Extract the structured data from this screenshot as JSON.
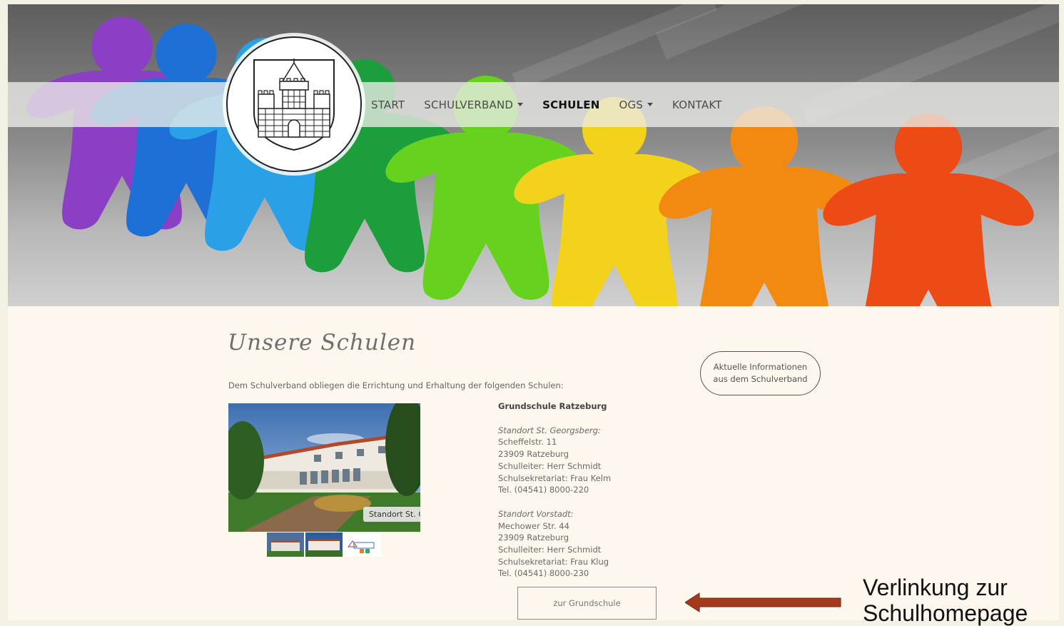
{
  "nav": {
    "items": [
      {
        "label": "START",
        "has_dropdown": false,
        "active": false
      },
      {
        "label": "SCHULVERBAND",
        "has_dropdown": true,
        "active": false
      },
      {
        "label": "SCHULEN",
        "has_dropdown": false,
        "active": true
      },
      {
        "label": "OGS",
        "has_dropdown": true,
        "active": false
      },
      {
        "label": "KONTAKT",
        "has_dropdown": false,
        "active": false
      }
    ]
  },
  "logo": {
    "icon": "castle-coat-of-arms"
  },
  "content": {
    "title": "Unsere Schulen",
    "intro": "Dem Schulverband obliegen die Errichtung und Erhaltung der folgenden Schulen:",
    "gallery": {
      "caption": "Standort St. Ge",
      "thumbnails": [
        "thumbnail-building-1",
        "thumbnail-building-2",
        "thumbnail-school-logo"
      ]
    },
    "school": {
      "name": "Grundschule Ratzeburg",
      "locations": [
        {
          "heading": "Standort St. Georgsberg:",
          "lines": [
            "Scheffelstr. 11",
            "23909 Ratzeburg",
            "Schulleiter: Herr Schmidt",
            "Schulsekretariat: Frau Kelm",
            "Tel. (04541) 8000-220"
          ]
        },
        {
          "heading": "Standort Vorstadt:",
          "lines": [
            "Mechower Str. 44",
            "23909 Ratzeburg",
            "Schulleiter: Herr Schmidt",
            "Schulsekretariat: Frau Klug",
            "Tel. (04541) 8000-230"
          ]
        }
      ],
      "button_label": "zur Grundschule"
    },
    "sidebar_button": {
      "line1": "Aktuelle Informationen",
      "line2": "aus dem Schulverband"
    }
  },
  "annotation": {
    "line1": "Verlinkung zur",
    "line2": "Schulhomepage",
    "arrow_color": "#a33a1e"
  },
  "colors": {
    "page_bg": "#fdf7ee",
    "accent_arrow": "#a33a1e"
  }
}
